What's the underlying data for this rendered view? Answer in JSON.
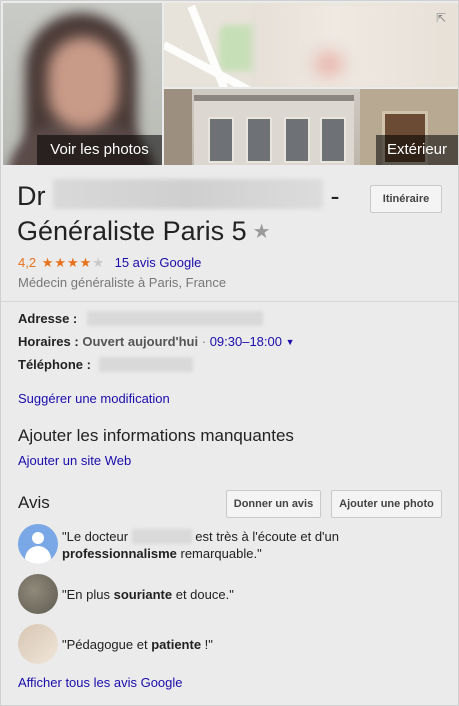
{
  "photos": {
    "see_photos_label": "Voir les photos",
    "exterior_label": "Extérieur"
  },
  "header": {
    "title_prefix": "Dr",
    "title_separator": "-",
    "title_suffix": "Généraliste Paris 5",
    "itinerary_button": "Itinéraire"
  },
  "rating": {
    "score": "4,2",
    "filled_stars": 4,
    "total_stars": 5,
    "reviews_link": "15 avis Google"
  },
  "category": "Médecin généraliste à Paris, France",
  "info": {
    "address_label": "Adresse :",
    "hours_label": "Horaires :",
    "open_status": "Ouvert aujourd'hui",
    "hours_separator": "·",
    "hours_value": "09:30–18:00",
    "phone_label": "Téléphone :"
  },
  "suggest_edit": "Suggérer une modification",
  "missing": {
    "title": "Ajouter les informations manquantes",
    "add_website": "Ajouter un site Web"
  },
  "reviews": {
    "title": "Avis",
    "give_review_button": "Donner un avis",
    "add_photo_button": "Ajouter une photo",
    "items": [
      {
        "part1": "\"Le docteur ",
        "part2": " est très à l'écoute et d'un ",
        "bold": "professionnalisme",
        "part3": " remarquable.\""
      },
      {
        "part1": "\"En plus ",
        "bold": "souriante",
        "part2": " et douce.\""
      },
      {
        "part1": "\"Pédagogue et ",
        "bold": "patiente",
        "part2": " !\""
      }
    ],
    "see_all": "Afficher tous les avis Google"
  },
  "colors": {
    "accent_star": "#e7711b",
    "link": "#1a0dab"
  }
}
